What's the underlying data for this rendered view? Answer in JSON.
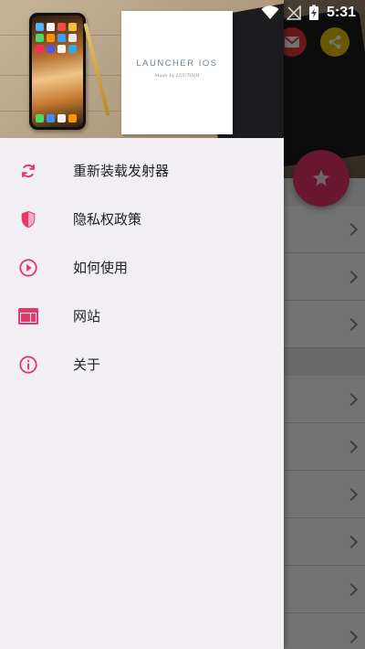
{
  "status_bar": {
    "time": "5:31"
  },
  "drawer": {
    "header": {
      "notebook_title": "LAUNCHER IOS",
      "notebook_subtitle": "Made by LUUTINH"
    },
    "items": [
      {
        "label": "重新装载发射器",
        "icon": "refresh-icon"
      },
      {
        "label": "隐私权政策",
        "icon": "shield-icon"
      },
      {
        "label": "如何使用",
        "icon": "play-circle-icon"
      },
      {
        "label": "网站",
        "icon": "web-icon"
      },
      {
        "label": "关于",
        "icon": "info-icon"
      }
    ]
  },
  "colors": {
    "accent": "#e4376b",
    "drawer_bg": "#f1eff3",
    "gmail": "#e53935",
    "share": "#e6c400"
  }
}
